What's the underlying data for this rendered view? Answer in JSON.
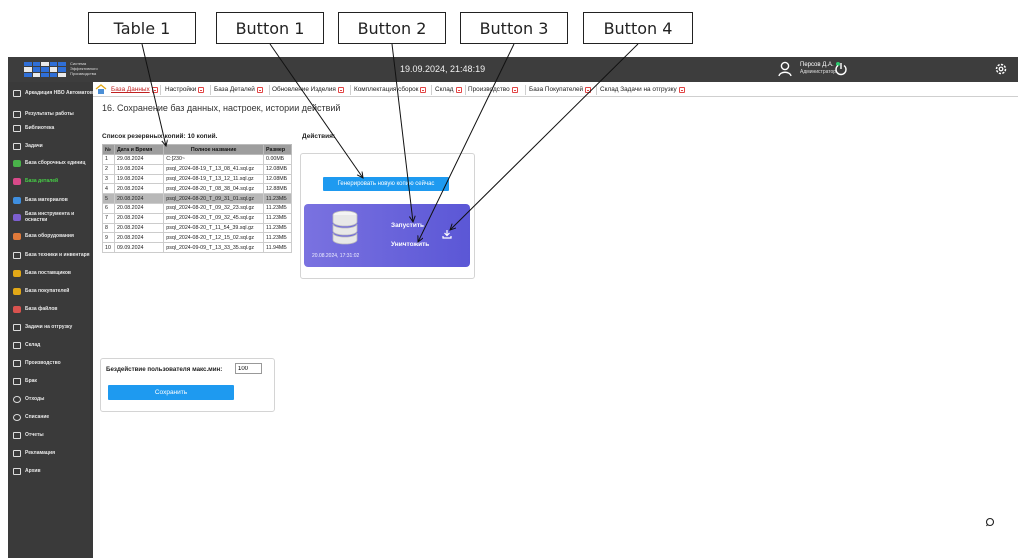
{
  "annotations": {
    "table1": "Table 1",
    "button1": "Button 1",
    "button2": "Button 2",
    "button3": "Button 3",
    "button4": "Button 4"
  },
  "topbar": {
    "logo_text": "Система Эффективного Производства",
    "datetime": "19.09.2024, 21:48:19",
    "user_name": "Персов Д.А.",
    "user_role": "Администратор"
  },
  "sidebar": {
    "items": [
      {
        "label": "Аркадиция НВО Автоматов",
        "icon": "home-icon"
      },
      {
        "label": "Результаты работы",
        "icon": "chart-icon"
      },
      {
        "label": "Библиотека",
        "icon": "books-icon"
      },
      {
        "label": "Задачи",
        "icon": "tasks-icon"
      },
      {
        "label": "База сборочных единиц",
        "icon": "database-icon"
      },
      {
        "label": "База деталей",
        "icon": "database-icon"
      },
      {
        "label": "База материалов",
        "icon": "database-icon"
      },
      {
        "label": "База инструмента и оснастки",
        "icon": "database-icon"
      },
      {
        "label": "База оборудования",
        "icon": "database-icon"
      },
      {
        "label": "База техники и инвентаря",
        "icon": "database-icon"
      },
      {
        "label": "База поставщиков",
        "icon": "database-icon"
      },
      {
        "label": "База покупателей",
        "icon": "database-icon"
      },
      {
        "label": "База файлов",
        "icon": "database-icon"
      },
      {
        "label": "Задачи на отгрузку",
        "icon": "shipping-icon"
      },
      {
        "label": "Склад",
        "icon": "warehouse-icon"
      },
      {
        "label": "Производство",
        "icon": "factory-icon"
      },
      {
        "label": "Брак",
        "icon": "defect-icon"
      },
      {
        "label": "Отходы",
        "icon": "recycle-icon"
      },
      {
        "label": "Списание",
        "icon": "writeoff-icon"
      },
      {
        "label": "Отчеты",
        "icon": "reports-icon"
      },
      {
        "label": "Рекламация",
        "icon": "claims-icon"
      },
      {
        "label": "Архив",
        "icon": "archive-icon"
      }
    ],
    "active_color": "#46d046",
    "db_colors": [
      "#4ab34a",
      "#e2a817",
      "#3f8fe0",
      "#7d5fd0",
      "#d9534f",
      "#5aa0e6",
      "#e2a817",
      "#4ab34a",
      "#d9534f"
    ]
  },
  "tabs": [
    {
      "label": "База Данных"
    },
    {
      "label": "Настройки"
    },
    {
      "label": "База Деталей"
    },
    {
      "label": "Обновление Изделия"
    },
    {
      "label": "Комплектация сборок"
    },
    {
      "label": "Склад"
    },
    {
      "label": "Производство"
    },
    {
      "label": "База Покупателей"
    },
    {
      "label": "Склад Задачи на отгрузку"
    }
  ],
  "page_title": "16. Сохранение баз данных, настроек, истории действий",
  "backups": {
    "caption": "Список резервных копий: 10 копий.",
    "columns": [
      "№",
      "Дата и Время",
      "Полное название",
      "Размер"
    ],
    "rows": [
      [
        "1",
        "29.08.2024",
        "C:[230~",
        "0.00МБ"
      ],
      [
        "2",
        "19.08.2024",
        "psql_2024-08-19_T_13_08_41.sql.gz",
        "12.08МБ"
      ],
      [
        "3",
        "19.08.2024",
        "psql_2024-08-19_T_13_12_11.sql.gz",
        "12.08МБ"
      ],
      [
        "4",
        "20.08.2024",
        "psql_2024-08-20_T_08_38_04.sql.gz",
        "12.88МБ"
      ],
      [
        "5",
        "20.08.2024",
        "psql_2024-08-20_T_09_31_01.sql.gz",
        "11.23МБ"
      ],
      [
        "6",
        "20.08.2024",
        "psql_2024-08-20_T_09_32_23.sql.gz",
        "11.23МБ"
      ],
      [
        "7",
        "20.08.2024",
        "psql_2024-08-20_T_09_32_45.sql.gz",
        "11.23МБ"
      ],
      [
        "8",
        "20.08.2024",
        "psql_2024-08-20_T_11_54_39.sql.gz",
        "11.23МБ"
      ],
      [
        "9",
        "20.08.2024",
        "psql_2024-08-20_T_12_15_02.sql.gz",
        "11.23МБ"
      ],
      [
        "10",
        "09.09.2024",
        "psql_2024-09-09_T_13_33_35.sql.gz",
        "11.94МБ"
      ]
    ],
    "selected_row": 5
  },
  "actions": {
    "caption": "Действия:",
    "generate_label": "Генерировать новую копию сейчас",
    "card_date": "20.08.2024, 17:31:02",
    "run_label": "Запустить",
    "destroy_label": "Уничтожить"
  },
  "idle": {
    "label": "Бездействие пользователя макс.мин:",
    "value": "100",
    "save_label": "Сохранить"
  },
  "colors": {
    "primary_button": "#1e9af0",
    "card_gradient_start": "#7a72e0",
    "card_gradient_end": "#5b57d6",
    "tab_close": "#e24545",
    "topbar": "#3d3d3d",
    "sidebar": "#3a3a3a"
  }
}
